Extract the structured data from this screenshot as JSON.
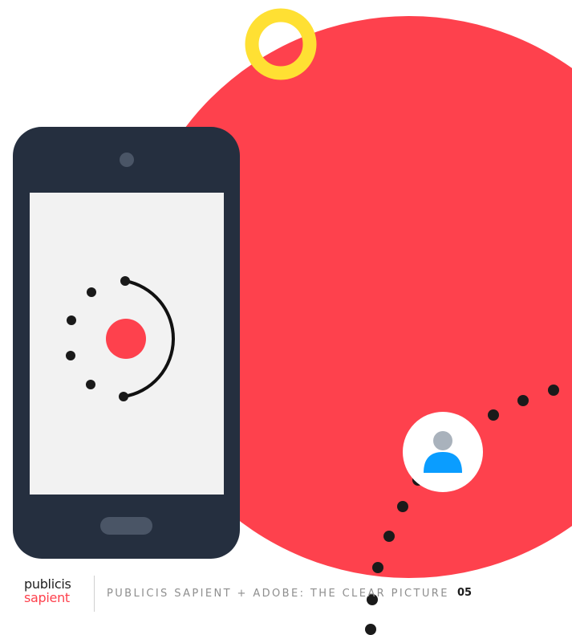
{
  "footer": {
    "logo_line1": "publicis",
    "logo_line2": "sapient",
    "title": "PUBLICIS SAPIENT + ADOBE: THE CLEAR PICTURE",
    "page_number": "05"
  },
  "colors": {
    "brand_red": "#fe414d",
    "yellow": "#ffe033",
    "phone_body": "#252f3f",
    "screen_bg": "#f2f2f2",
    "dot_black": "#1a1a1a",
    "avatar_blue": "#0a9dff",
    "avatar_gray": "#a9b2bc"
  },
  "icons": {
    "phone": "smartphone-icon",
    "user": "user-avatar-icon",
    "ring": "yellow-ring-shape"
  }
}
